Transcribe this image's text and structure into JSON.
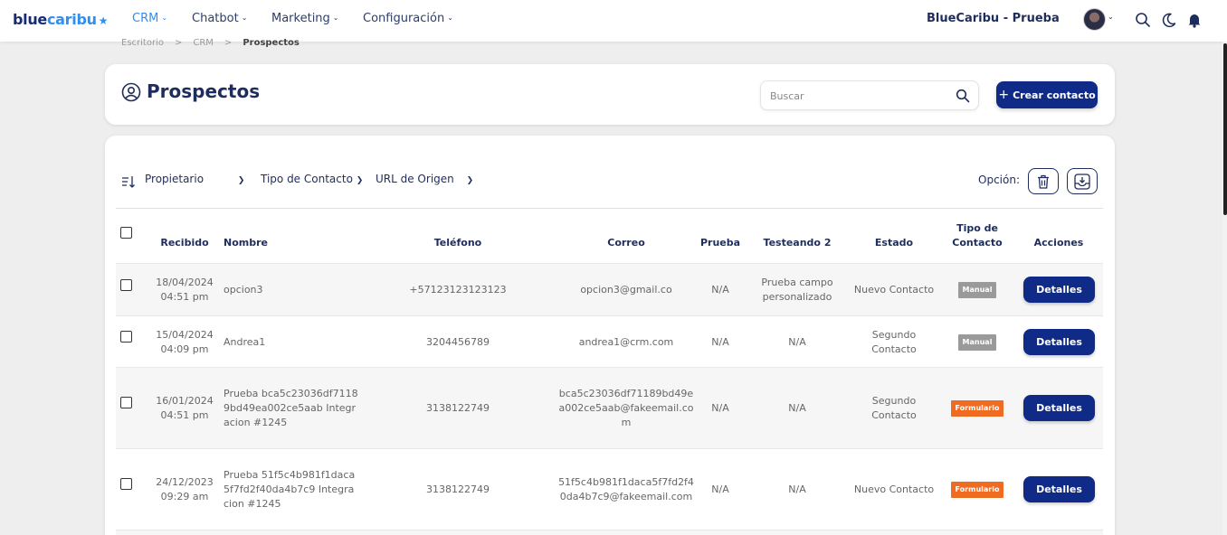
{
  "nav": {
    "logo_part1": "blue",
    "logo_part2": "caribu",
    "items": [
      {
        "label": "CRM",
        "active": true
      },
      {
        "label": "Chatbot",
        "active": false
      },
      {
        "label": "Marketing",
        "active": false
      },
      {
        "label": "Configuración",
        "active": false
      }
    ],
    "account_name": "BlueCaribu - Prueba",
    "icons": [
      "avatar",
      "search-icon",
      "moon-icon",
      "bell-icon"
    ]
  },
  "breadcrumb": [
    "Escritorio",
    "CRM",
    "Prospectos"
  ],
  "header": {
    "title": "Prospectos",
    "search_placeholder": "Buscar",
    "create_label": "Crear contacto"
  },
  "filters": {
    "owner": "Propietario",
    "contact_type": "Tipo de Contacto",
    "origin_url": "URL de Origen",
    "option_label": "Opción:"
  },
  "table": {
    "columns": {
      "received": "Recibido",
      "name": "Nombre",
      "phone": "Teléfono",
      "email": "Correo",
      "prueba": "Prueba",
      "testeando": "Testeando 2",
      "status": "Estado",
      "contact_type_1": "Tipo de",
      "contact_type_2": "Contacto",
      "actions": "Acciones"
    },
    "rows": [
      {
        "date": "18/04/2024",
        "time": "04:51 pm",
        "name": "opcion3",
        "phone": "+57123123123123",
        "email": "opcion3@gmail.co",
        "prueba": "N/A",
        "testeando": "Prueba campo personalizado",
        "status": "Nuevo Contacto",
        "type": "Manual",
        "action": "Detalles"
      },
      {
        "date": "15/04/2024",
        "time": "04:09 pm",
        "name": "Andrea1",
        "phone": "3204456789",
        "email": "andrea1@crm.com",
        "prueba": "N/A",
        "testeando": "N/A",
        "status": "Segundo Contacto",
        "type": "Manual",
        "action": "Detalles"
      },
      {
        "date": "16/01/2024",
        "time": "04:51 pm",
        "name": "Prueba bca5c23036df71189bd49ea002ce5aab Integracion #1245",
        "phone": "3138122749",
        "email": "bca5c23036df71189bd49ea002ce5aab@fakeemail.com",
        "prueba": "N/A",
        "testeando": "N/A",
        "status": "Segundo Contacto",
        "type": "Formulario",
        "action": "Detalles"
      },
      {
        "date": "24/12/2023",
        "time": "09:29 am",
        "name": "Prueba 51f5c4b981f1daca5f7fd2f40da4b7c9 Integracion #1245",
        "phone": "3138122749",
        "email": "51f5c4b981f1daca5f7fd2f40da4b7c9@fakeemail.com",
        "prueba": "N/A",
        "testeando": "N/A",
        "status": "Nuevo Contacto",
        "type": "Formulario",
        "action": "Detalles"
      }
    ]
  },
  "colors": {
    "primary": "#0f2a87",
    "nav_active": "#2f8ef0",
    "badge_manual": "#9a9a9a",
    "badge_form": "#f06b22"
  }
}
